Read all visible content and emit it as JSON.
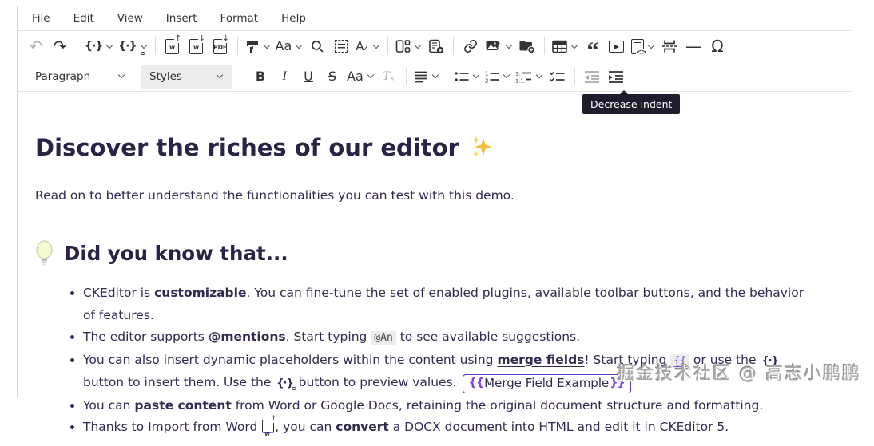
{
  "menu_bar": {
    "items": [
      "File",
      "Edit",
      "View",
      "Insert",
      "Format",
      "Help"
    ]
  },
  "toolbar1": {
    "items": [
      {
        "name": "undo",
        "glyph": "↶",
        "disabled": true
      },
      {
        "name": "redo",
        "glyph": "↷"
      },
      {
        "name": "insert-merge-field",
        "glyph": "{·}",
        "dropdown": true
      },
      {
        "name": "preview-merge-fields",
        "glyph": "{·}",
        "dropdown": true
      },
      {
        "name": "import-from-word",
        "glyph": "w",
        "arrow": "↑"
      },
      {
        "name": "export-to-word",
        "glyph": "w",
        "arrow": "↓"
      },
      {
        "name": "export-to-pdf",
        "glyph": "PDF",
        "arrow": "↓"
      },
      {
        "name": "format-painter",
        "dropdown": true
      },
      {
        "name": "case-change",
        "glyph": "Aa",
        "dropdown": true
      },
      {
        "name": "find-and-replace"
      },
      {
        "name": "select-all"
      },
      {
        "name": "spell-check",
        "glyph": "A",
        "check": "✓",
        "dropdown": true
      },
      {
        "name": "multi-column-layout",
        "dropdown": true
      },
      {
        "name": "insert-template"
      },
      {
        "name": "link"
      },
      {
        "name": "insert-image",
        "dropdown": true
      },
      {
        "name": "file-manager"
      },
      {
        "name": "insert-table",
        "dropdown": true
      },
      {
        "name": "block-quote",
        "glyph": "“"
      },
      {
        "name": "insert-media",
        "glyph": "▶"
      },
      {
        "name": "html-embed",
        "glyph": "<>",
        "dropdown": true
      },
      {
        "name": "page-break"
      },
      {
        "name": "horizontal-line",
        "glyph": "—"
      },
      {
        "name": "special-characters",
        "glyph": "Ω"
      }
    ]
  },
  "toolbar2": {
    "paragraph": "Paragraph",
    "styles": "Styles",
    "bold": "B",
    "italic": "I",
    "underline": "U",
    "strikethrough": "S",
    "font_size": "Aa",
    "remove_format_t": "T",
    "remove_format_x": "×"
  },
  "tooltip": {
    "text": "Decrease indent"
  },
  "content": {
    "h1": "Discover the riches of our editor",
    "intro": "Read on to better understand the functionalities you can test with this demo.",
    "h2": "Did you know that...",
    "b1": {
      "t1": "CKEditor is ",
      "bold": "customizable",
      "t2": ". You can fine-tune the set of enabled plugins, available toolbar buttons, and the behavior of features."
    },
    "b2": {
      "t1": "The editor supports ",
      "bold": "@mentions",
      "t2": ". Start typing ",
      "code": "@An",
      "t3": " to see available suggestions."
    },
    "b3": {
      "t1": "You can also insert dynamic placeholders within the content using ",
      "link": "merge fields",
      "t2": "! Start typing ",
      "code": "{{",
      "t3": " or use the ",
      "icon1": "{·}",
      "t4": " button to insert them. Use the ",
      "icon2": "{·}",
      "t5": " button to preview values. ",
      "widget_open": "{{",
      "widget_label": "Merge Field Example",
      "widget_close": "}}"
    },
    "b4": {
      "t1": "You can ",
      "bold": "paste content",
      "t2": " from Word or Google Docs, retaining the original document structure and formatting."
    },
    "b5": {
      "t1": "Thanks to Import from Word ",
      "word_label": "w",
      "word_arrow": "↑",
      "t2": ", you can ",
      "bold": "convert",
      "t3": " a DOCX document into HTML and edit it in CKEditor 5."
    }
  },
  "watermark": "掘金技术社区 @ 高志小鹏鹏",
  "colors": {
    "accent_purple": "#7b3fe4",
    "widget_border": "#5d35c7",
    "text_navy": "#2e2c50",
    "heading_navy": "#262447",
    "tooltip_bg": "#1d1d2b",
    "toolbar_icon": "#333333",
    "disabled_icon": "#b3b3b3",
    "sparkle_gold": "#f2c037",
    "bulb_fill": "#f5f9d0"
  }
}
